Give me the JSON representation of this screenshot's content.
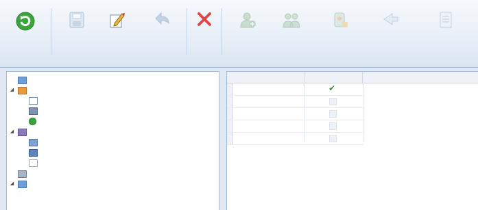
{
  "ribbon": {
    "buttons": [
      {
        "label": "",
        "icon": "refresh-icon"
      },
      {
        "label": "",
        "icon": "save-icon"
      },
      {
        "label": "",
        "icon": "edit-icon"
      },
      {
        "label": "",
        "icon": "undo-icon"
      },
      {
        "label": "",
        "icon": "delete-icon"
      },
      {
        "label": "",
        "icon": "add-employee-icon"
      },
      {
        "label": "",
        "icon": "add-group-icon"
      },
      {
        "label": "",
        "icon": "add-access-rule-icon"
      },
      {
        "label": "",
        "icon": "add-schedule-icon"
      },
      {
        "label": "",
        "icon": "add-report-icon"
      }
    ],
    "groups": [
      "",
      ""
    ]
  },
  "tree": {
    "items": [
      {
        "label": "",
        "icon": "folder-icon"
      },
      {
        "label": "",
        "icon": "employees-icon"
      },
      {
        "label": "",
        "icon": "fields-icon"
      },
      {
        "label": "",
        "icon": "photo-icon"
      },
      {
        "label": "",
        "icon": "biometrics-icon"
      },
      {
        "label": "",
        "icon": "time-tracking-icon"
      },
      {
        "label": "",
        "icon": "schedule-icon"
      },
      {
        "label": "",
        "icon": "workday-icon"
      },
      {
        "label": "",
        "icon": "day-types-icon"
      },
      {
        "label": "",
        "icon": "system-icon"
      },
      {
        "label": "",
        "icon": "users-icon"
      }
    ]
  },
  "grid": {
    "headers": [
      "",
      ""
    ],
    "rows": [
      {
        "label": "",
        "checked": true
      },
      {
        "label": "",
        "checked": false
      },
      {
        "label": "",
        "checked": false
      },
      {
        "label": "",
        "checked": false
      },
      {
        "label": "",
        "checked": false
      }
    ]
  },
  "colors": {
    "refresh_green": "#3aa53a",
    "delete_red": "#e04848",
    "check_green": "#2e9a2e",
    "folder_orange": "#e89a3c"
  }
}
